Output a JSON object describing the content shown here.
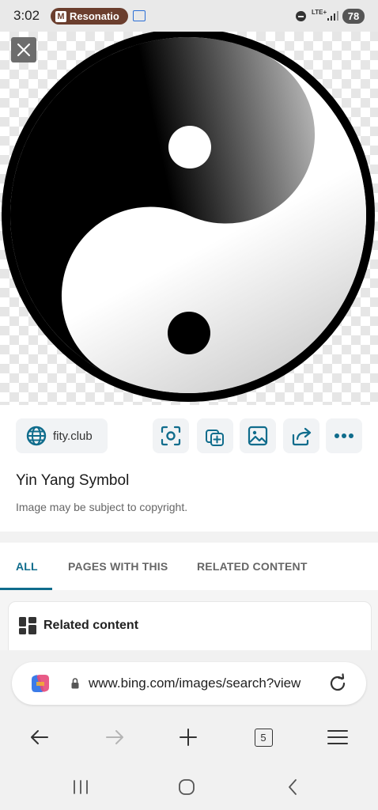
{
  "status_bar": {
    "time": "3:02",
    "notification_label": "Resonatio",
    "notification_badge": "M",
    "network": "LTE+",
    "battery": "78"
  },
  "image": {
    "subject_icon": "yin-yang-symbol",
    "colors": {
      "dark": "#000000",
      "light": "#ffffff"
    }
  },
  "info": {
    "source": "fity.club",
    "title": "Yin Yang Symbol",
    "copyright": "Image may be subject to copyright.",
    "actions": [
      "visual-search-icon",
      "add-to-collection-icon",
      "image-icon",
      "share-icon",
      "more-icon"
    ]
  },
  "tabs": [
    {
      "label": "ALL",
      "active": true
    },
    {
      "label": "PAGES WITH THIS",
      "active": false
    },
    {
      "label": "RELATED CONTENT",
      "active": false
    }
  ],
  "related": {
    "heading": "Related content"
  },
  "browser": {
    "url": "www.bing.com/images/search?view",
    "tab_count": "5"
  },
  "accent_color": "#0f6c8c"
}
